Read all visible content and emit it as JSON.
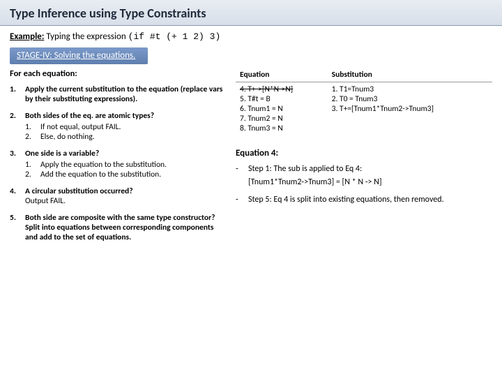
{
  "title": "Type Inference using Type Constraints",
  "example": {
    "label": "Example:",
    "intro": "Typing the expression",
    "code": "(if #t  (+ 1 2)  3)"
  },
  "stage": "STAGE-IV: Solving the equations.",
  "forEach": "For each equation:",
  "steps": {
    "s1": "Apply the current substitution to the equation (replace vars by their substituting expressions).",
    "s2h": "Both sides of the eq. are atomic types?",
    "s2a": "If not equal, output FAIL.",
    "s2b": "Else, do nothing.",
    "s3h": "One side is a variable?",
    "s3a": "Apply the equation to the substitution.",
    "s3b": "Add the equation to the substitution.",
    "s4h": "A circular substitution occurred?",
    "s4b": "Output FAIL.",
    "s5": "Both side are composite with the same type constructor?\nSplit into equations between corresponding components and add to the set of equations."
  },
  "table": {
    "h1": "Equation",
    "h2": "Substitution",
    "eqs": {
      "e4": "4. T+->[N*N->N]",
      "e5": "5. T#t = B",
      "e6": "6. Tnum1 = N",
      "e7": "7. Tnum2 = N",
      "e8": "8. Tnum3 = N"
    },
    "subs": {
      "s1": "1. T1=Tnum3",
      "s2": "2. T0 = Tnum3",
      "s3": "3. T+=[Tnum1*Tnum2->Tnum3]"
    }
  },
  "explain": {
    "hd": "Equation 4:",
    "l1": "Step 1: The sub is applied to Eq 4:",
    "l1b": "[Tnum1*Tnum2->Tnum3] = [N * N -> N]",
    "l2": "Step 5: Eq 4 is split into existing equations, then removed."
  }
}
